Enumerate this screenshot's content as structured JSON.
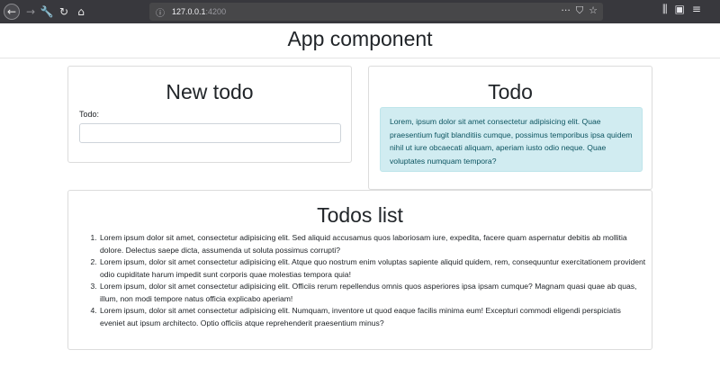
{
  "browser": {
    "url_host": "127.0.0.1",
    "url_port": ":4200"
  },
  "header": {
    "title": "App component"
  },
  "new_todo": {
    "title": "New todo",
    "field_label": "Todo:",
    "field_value": ""
  },
  "todo": {
    "title": "Todo",
    "text": "Lorem, ipsum dolor sit amet consectetur adipisicing elit. Quae praesentium fugit blanditiis cumque, possimus temporibus ipsa quidem nihil ut iure obcaecati aliquam, aperiam iusto odio neque. Quae voluptates numquam tempora?"
  },
  "todos_list": {
    "title": "Todos list",
    "items": [
      "Lorem ipsum dolor sit amet, consectetur adipisicing elit. Sed aliquid accusamus quos laboriosam iure, expedita, facere quam aspernatur debitis ab mollitia dolore. Delectus saepe dicta, assumenda ut soluta possimus corrupti?",
      "Lorem ipsum, dolor sit amet consectetur adipisicing elit. Atque quo nostrum enim voluptas sapiente aliquid quidem, rem, consequuntur exercitationem provident odio cupiditate harum impedit sunt corporis quae molestias tempora quia!",
      "Lorem ipsum, dolor sit amet consectetur adipisicing elit. Officiis rerum repellendus omnis quos asperiores ipsa ipsam cumque? Magnam quasi quae ab quas, illum, non modi tempore natus officia explicabo aperiam!",
      "Lorem ipsum, dolor sit amet consectetur adipisicing elit. Numquam, inventore ut quod eaque facilis minima eum! Excepturi commodi eligendi perspiciatis eveniet aut ipsum architecto. Optio officiis atque reprehenderit praesentium minus?"
    ]
  }
}
